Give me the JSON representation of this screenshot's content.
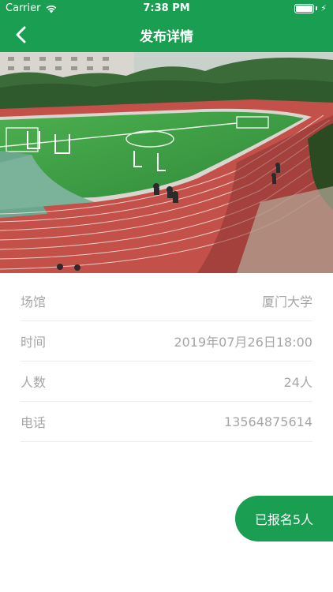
{
  "status_bar": {
    "carrier": "Carrier",
    "time": "7:38 PM",
    "icons": [
      "wifi-icon",
      "battery-icon",
      "charging-bolt-icon"
    ]
  },
  "nav": {
    "title": "发布详情",
    "back_icon": "chevron-left-icon"
  },
  "colors": {
    "brand_green": "#1a9e52",
    "label_gray": "#a6a6a6",
    "divider": "#ececec"
  },
  "hero_image": {
    "subject": "running-track-and-football-field-photo"
  },
  "details": [
    {
      "label": "场馆",
      "value": "厦门大学"
    },
    {
      "label": "时间",
      "value": "2019年07月26日18:00"
    },
    {
      "label": "人数",
      "value": "24人"
    },
    {
      "label": "电话",
      "value": "13564875614"
    }
  ],
  "signup_button": {
    "label": "已报名5人"
  }
}
